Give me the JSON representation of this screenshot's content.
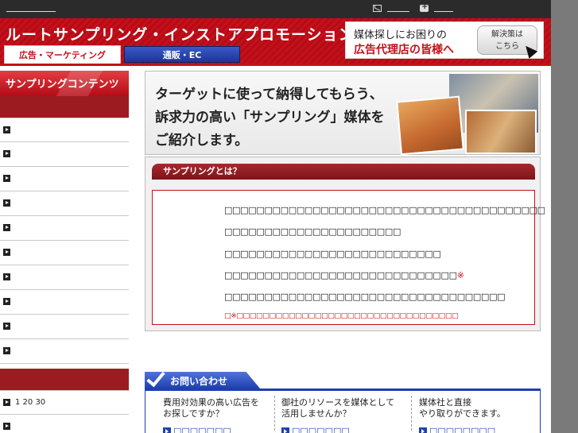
{
  "topbar": {
    "mail_icon": "mail-icon",
    "plus_icon": "plus-icon"
  },
  "header": {
    "site_title": "ルートサンプリング・インストアプロモーション",
    "promo_line1": "媒体探しにお困りの",
    "promo_line2": "広告代理店の皆様へ",
    "solve_btn_line1": "解決策は",
    "solve_btn_line2": "こちら"
  },
  "tabs": [
    {
      "label": "広告・マーケティング"
    },
    {
      "label": "通販・EC"
    }
  ],
  "sidebar": {
    "title": "サンプリングコンテンツ",
    "items_a": [
      {
        "label": ""
      },
      {
        "label": ""
      },
      {
        "label": ""
      },
      {
        "label": ""
      },
      {
        "label": ""
      },
      {
        "label": ""
      },
      {
        "label": ""
      },
      {
        "label": ""
      },
      {
        "label": ""
      },
      {
        "label": ""
      }
    ],
    "items_b": [
      {
        "label": "1 20 30"
      },
      {
        "label": ""
      }
    ]
  },
  "hero": {
    "line1": "ターゲットに使って納得してもらう、",
    "line2": "訴求力の高い「サンプリング」媒体を",
    "line3": "ご紹介します。"
  },
  "about": {
    "title": "サンプリングとは？",
    "lines": [
      "□□□□□□□□□□□□□□□□□□□□□□□□□□□□□□□□□□□□□□□□",
      "□□□□□□□□□□□□□□□□□□□□□□",
      "□□□□□□□□□□□□□□□□□□□□□□□□□□□",
      "□□□□□□□□□□□□□□□□□□□□□□□□□□□□□",
      "□□□□□□□□□□□□□□□□□□□□□□□□□□□□□□□□□□□"
    ],
    "asterisk": "※",
    "note": "□※□□□□□□□□□□□□□□□□□□□□□□□□□□□□□□□□□□"
  },
  "contact": {
    "tab_label": "お問い合わせ",
    "cols": [
      {
        "line1": "費用対効果の高い広告を",
        "line2": "お探しですか？",
        "link": "□□□□□□□"
      },
      {
        "line1": "御社のリソースを媒体として",
        "line2": "活用しませんか？",
        "link": "□□□□□□□"
      },
      {
        "line1": "媒体社と直接",
        "line2": "やり取りができます。",
        "link": "□□□□□□□□"
      }
    ]
  }
}
